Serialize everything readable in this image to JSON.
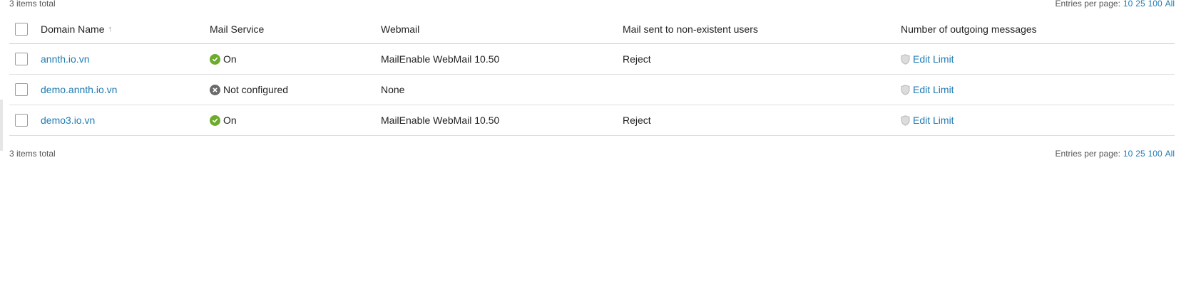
{
  "summary": {
    "items_total": "3 items total",
    "entries_label": "Entries per page:",
    "entries_options": [
      "10",
      "25",
      "100",
      "All"
    ]
  },
  "table": {
    "headers": {
      "domain": "Domain Name",
      "service": "Mail Service",
      "webmail": "Webmail",
      "nonexistent": "Mail sent to non-existent users",
      "outgoing": "Number of outgoing messages"
    },
    "sort_indicator": "↑",
    "rows": [
      {
        "domain": "annth.io.vn",
        "service_status": "check-circle-icon",
        "service": "On",
        "webmail": "MailEnable WebMail 10.50",
        "nonexistent": "Reject",
        "outgoing_icon": "shield-icon",
        "outgoing": "Edit Limit"
      },
      {
        "domain": "demo.annth.io.vn",
        "service_status": "x-circle-icon",
        "service": "Not configured",
        "webmail": "None",
        "nonexistent": "",
        "outgoing_icon": "shield-icon",
        "outgoing": "Edit Limit"
      },
      {
        "domain": "demo3.io.vn",
        "service_status": "check-circle-icon",
        "service": "On",
        "webmail": "MailEnable WebMail 10.50",
        "nonexistent": "Reject",
        "outgoing_icon": "shield-icon",
        "outgoing": "Edit Limit"
      }
    ]
  },
  "colors": {
    "link": "#1f7bb3",
    "status_on": "#6cab2b",
    "status_off": "#6a6a6a"
  }
}
